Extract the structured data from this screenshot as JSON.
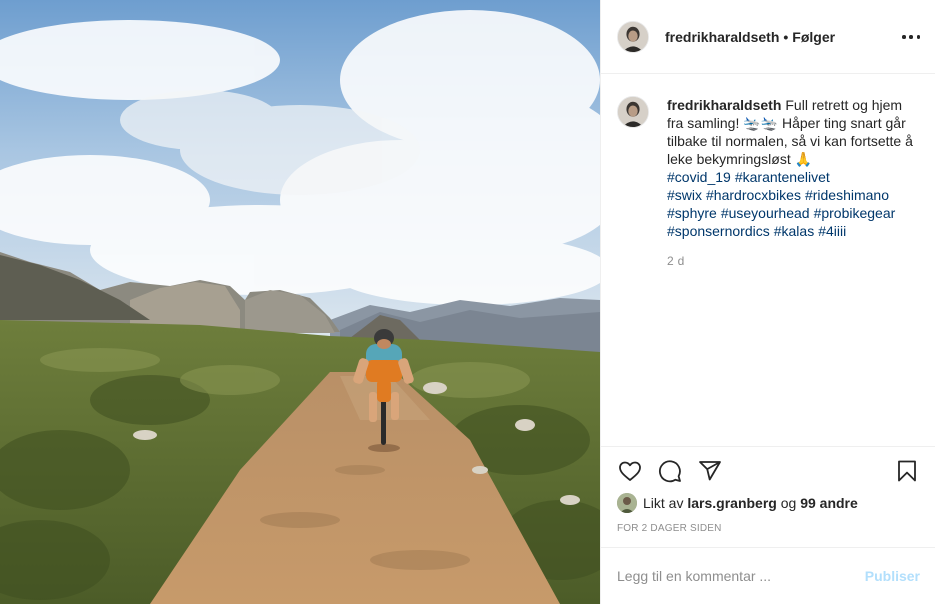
{
  "post": {
    "photo": {
      "alt_icon": "post-photo"
    },
    "author": {
      "username": "fredrikharaldseth",
      "separator": "•",
      "follow_label": "Følger"
    },
    "more_icon": "ellipsis-icon",
    "caption": {
      "username": "fredrikharaldseth",
      "text": "Full retrett og hjem fra samling! 🛬🛬 Håper ting snart går tilbake til normalen, så vi kan fortsette å leke bekymringsløst 🙏",
      "hashtags": [
        "#covid_19",
        "#karantenelivet",
        "#swix",
        "#hardrocxbikes",
        "#rideshimano",
        "#sphyre",
        "#useyourhead",
        "#probikegear",
        "#sponsernordics",
        "#kalas",
        "#4iiii"
      ],
      "time": "2 d"
    },
    "actions": {
      "like_icon": "heart-icon",
      "comment_icon": "comment-icon",
      "share_icon": "share-icon",
      "save_icon": "bookmark-icon"
    },
    "likes": {
      "prefix": "Likt av",
      "user": "lars.granberg",
      "conjunction": "og",
      "others": "99 andre"
    },
    "posted_ago": "FOR 2 DAGER SIDEN",
    "comment": {
      "placeholder": "Legg til en kommentar ...",
      "publish_label": "Publiser"
    },
    "colors": {
      "text": "#262626",
      "muted": "#8e8e8e",
      "hashtag": "#00376b",
      "publish_disabled": "#b2dffc",
      "divider": "#efefef"
    }
  }
}
